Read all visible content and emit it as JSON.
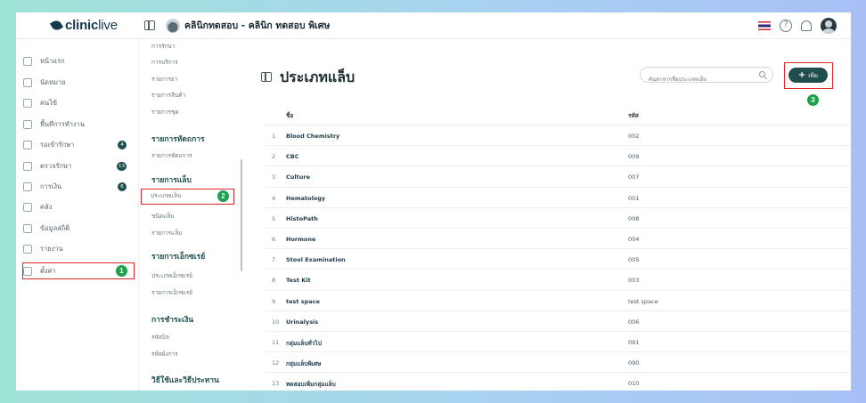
{
  "brand": {
    "name_bold": "clinic",
    "name_light": "live"
  },
  "header": {
    "clinic_name": "คลินิกทดสอบ - คลินิก ทดสอบ พิเศษ"
  },
  "nav": {
    "items": [
      {
        "label": "หน้าแรก"
      },
      {
        "label": "นัดหมาย"
      },
      {
        "label": "คนไข้"
      },
      {
        "label": "พื้นที่การทำงาน"
      },
      {
        "label": "รอเข้ารักษา",
        "badge": "4"
      },
      {
        "label": "ตรวจรักษา",
        "badge": "13"
      },
      {
        "label": "การเงิน",
        "badge": "6"
      },
      {
        "label": "คลัง"
      },
      {
        "label": "ข้อมูลสถิติ"
      },
      {
        "label": "รายงาน"
      },
      {
        "label": "ตั้งค่า",
        "step": "1"
      }
    ]
  },
  "subnav": {
    "items_top": [
      "การรักษา",
      "การบริการ",
      "รายการยา",
      "รายการสินค้า",
      "รายการชุด"
    ],
    "group_procedure": {
      "title": "รายการหัตถการ",
      "items": [
        "รายการหัตถการ"
      ]
    },
    "group_lab": {
      "title": "รายการแล็บ",
      "items": [
        "ประเภทแล็บ",
        "ชนิดแล็บ",
        "รายการแล็บ"
      ],
      "active_step": "2"
    },
    "group_xray": {
      "title": "รายการเอ็กซเรย์",
      "items": [
        "ประเภทเอ็กซเรย์",
        "รายการเอ็กซเรย์"
      ]
    },
    "group_payment": {
      "title": "การชำระเงิน",
      "items": [
        "รหัสบิล",
        "รหัสผังการ"
      ]
    },
    "group_usage": {
      "title": "วิธีใช้และวิธีประทาน"
    }
  },
  "page": {
    "title": "ประเภทแล็บ",
    "search_placeholder": "ค้นหาจากชื่อประเภทแล็บ",
    "add_label": "เพิ่ม",
    "add_step": "3"
  },
  "table": {
    "headers": {
      "name": "ชื่อ",
      "code": "รหัส"
    },
    "rows": [
      {
        "idx": "1",
        "name": "Blood Chemistry",
        "code": "002"
      },
      {
        "idx": "2",
        "name": "CBC",
        "code": "009"
      },
      {
        "idx": "3",
        "name": "Culture",
        "code": "007"
      },
      {
        "idx": "4",
        "name": "Hematology",
        "code": "001"
      },
      {
        "idx": "5",
        "name": "HistoPath",
        "code": "008"
      },
      {
        "idx": "6",
        "name": "Hormone",
        "code": "004"
      },
      {
        "idx": "7",
        "name": "Stool Examination",
        "code": "005"
      },
      {
        "idx": "8",
        "name": "Test Kit",
        "code": "003"
      },
      {
        "idx": "9",
        "name": "test space",
        "code": "test space"
      },
      {
        "idx": "10",
        "name": "Urinalysis",
        "code": "006"
      },
      {
        "idx": "11",
        "name": "กลุ่มแล็บทั่วไป",
        "code": "091"
      },
      {
        "idx": "12",
        "name": "กลุ่มแล็บพิเศษ",
        "code": "090"
      },
      {
        "idx": "13",
        "name": "ทดสอบเพิ่มกลุ่มแล็บ",
        "code": "010"
      }
    ]
  }
}
